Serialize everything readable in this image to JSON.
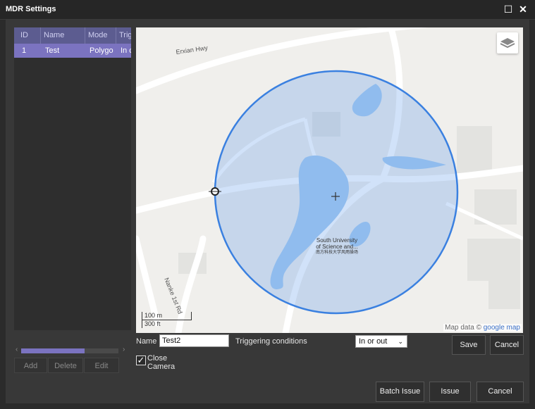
{
  "window": {
    "title": "MDR Settings",
    "maximize_icon": "maximize-icon",
    "close_icon": "close-icon"
  },
  "table": {
    "headers": [
      "ID",
      "Name",
      "Mode",
      "Trig"
    ],
    "rows": [
      {
        "id": "1",
        "name": "Test",
        "mode": "Polygo",
        "trig": "In c"
      }
    ]
  },
  "left_buttons": {
    "add": "Add",
    "delete": "Delete",
    "edit": "Edit"
  },
  "map": {
    "road_label": "Erxian Hwy",
    "road_label2": "Nanke 1st Rd",
    "campus_line1": "South University",
    "campus_line2": "of Science and...",
    "campus_line3": "南方科技大学风雨操场",
    "scale_m": "100 m",
    "scale_ft": "300 ft",
    "attribution": "Map data ©",
    "attribution_link": "google map",
    "circle_color": "#3a80e0",
    "layers_icon": "layers-icon"
  },
  "form": {
    "name_label": "Name",
    "name_value": "Test2",
    "trigger_label": "Triggering conditions",
    "trigger_value": "In or out",
    "close_camera_line1": "Close",
    "close_camera_line2": "Camera",
    "close_camera_checked": true
  },
  "buttons": {
    "save": "Save",
    "cancel_top": "Cancel",
    "batch_issue": "Batch Issue",
    "issue": "Issue",
    "cancel_bottom": "Cancel"
  }
}
